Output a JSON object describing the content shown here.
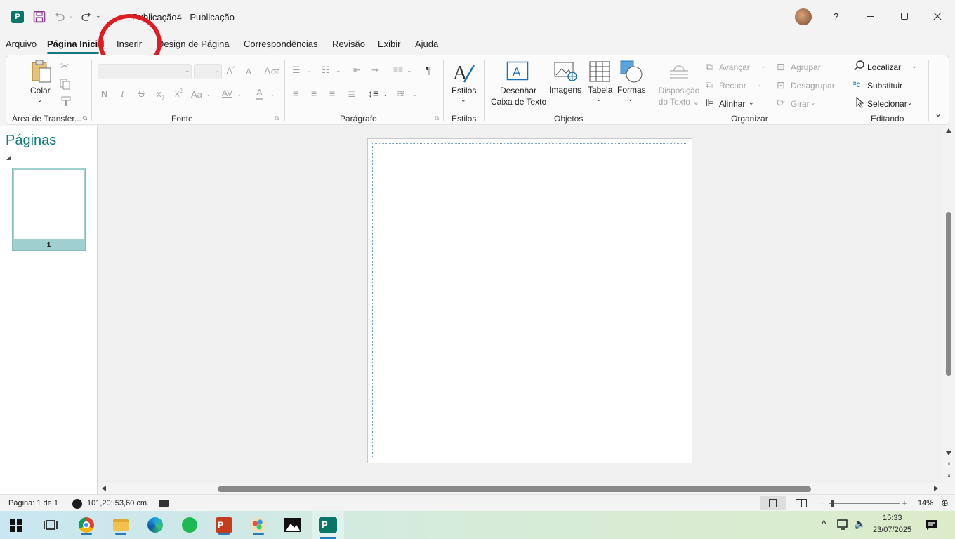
{
  "titlebar": {
    "doc_title": "Publicação4",
    "separator": " - ",
    "app_name": "Publicação",
    "help": "?"
  },
  "menu": {
    "tabs": [
      "Arquivo",
      "Página Inicial",
      "Inserir",
      "Design de Página",
      "Correspondências",
      "Revisão",
      "Exibir",
      "Ajuda"
    ],
    "active": "Página Inicial"
  },
  "ribbon": {
    "clipboard": {
      "paste": "Colar",
      "group": "Área de Transfer..."
    },
    "font": {
      "group": "Fonte",
      "bold": "N",
      "italic": "I",
      "strike": "S",
      "subscript": "x",
      "subscript_mark": "2",
      "superscript": "x",
      "superscript_mark": "2",
      "case": "Aa",
      "spacing": "AV",
      "color": "A"
    },
    "paragraph": {
      "group": "Parágrafo",
      "pilcrow": "¶"
    },
    "styles": {
      "button": "Estilos",
      "group": "Estilos"
    },
    "objects": {
      "draw_textbox_1": "Desenhar",
      "draw_textbox_2": "Caixa de Texto",
      "images": "Imagens",
      "table": "Tabela",
      "shapes": "Formas",
      "group": "Objetos"
    },
    "arrange": {
      "wrap_1": "Disposição",
      "wrap_2": "do Texto",
      "forward": "Avançar",
      "backward": "Recuar",
      "align": "Alinhar",
      "group_btn": "Agrupar",
      "ungroup": "Desagrupar",
      "rotate": "Girar",
      "group": "Organizar"
    },
    "editing": {
      "find": "Localizar",
      "replace": "Substituir",
      "select": "Selecionar",
      "group": "Editando"
    }
  },
  "pages_panel": {
    "title": "Páginas",
    "thumb_number": "1"
  },
  "statusbar": {
    "page_info": "Página: 1 de 1",
    "coords": "101,20; 53,60 cm.",
    "zoom": "14%"
  },
  "taskbar": {
    "time": "15:33",
    "date": "23/07/2025"
  },
  "colors": {
    "accent": "#0f7b7b",
    "publisher": "#077568",
    "annotation": "#e11b22"
  }
}
